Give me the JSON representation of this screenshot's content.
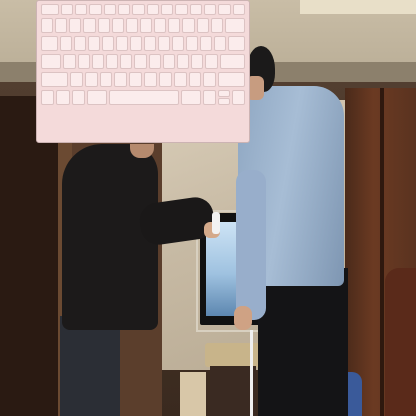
{
  "scene": {
    "description_visible": "",
    "keyboard_overlay": {
      "color": "#f4dada",
      "rows": [
        {
          "type": "fn",
          "count": 14
        },
        {
          "type": "number",
          "count": 14
        },
        {
          "type": "qwerty",
          "count": 14
        },
        {
          "type": "home",
          "count": 13
        },
        {
          "type": "shift",
          "count": 12
        },
        {
          "type": "bottom",
          "count": 9
        }
      ]
    }
  }
}
